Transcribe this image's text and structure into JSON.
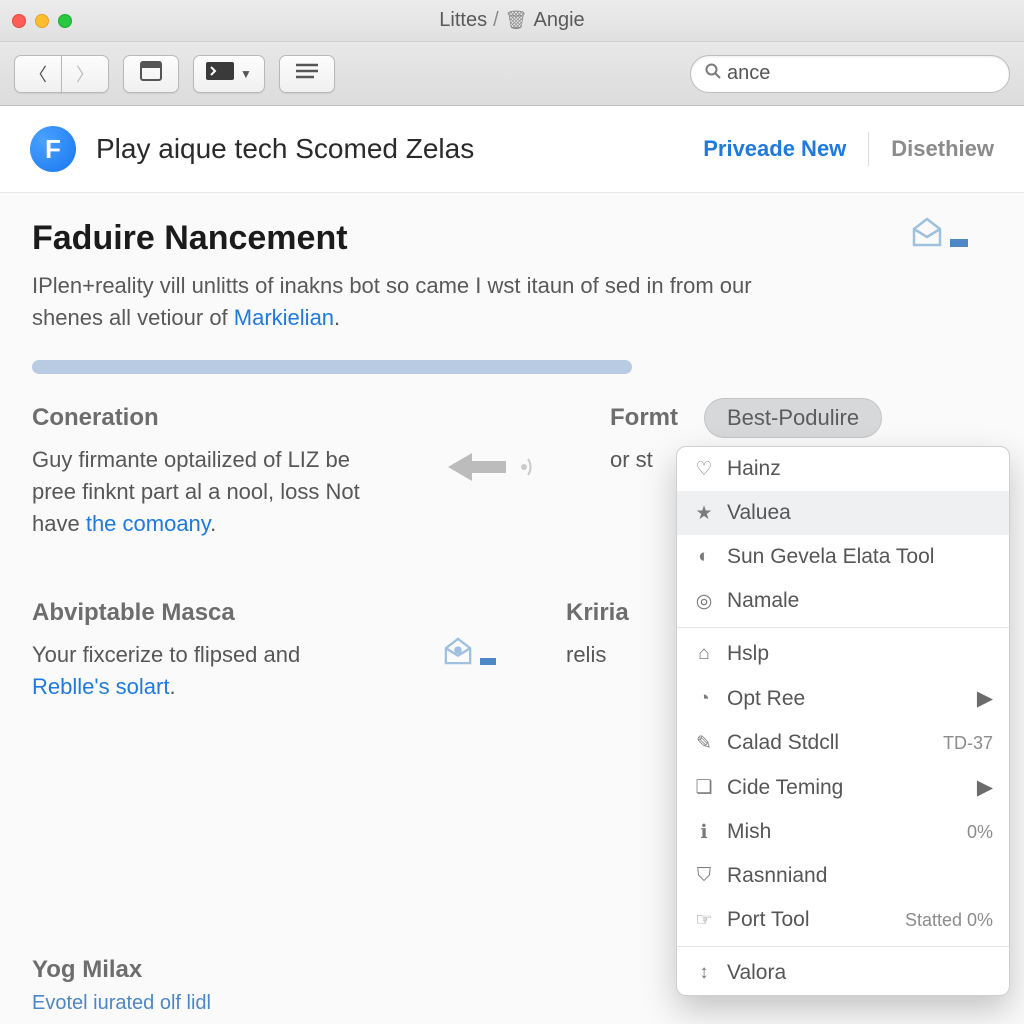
{
  "window": {
    "title_left": "Littes",
    "title_right": "Angie"
  },
  "toolbar": {
    "search_value": "ance"
  },
  "header": {
    "logo_letter": "F",
    "title": "Play aique tech Scomed Zelas",
    "link_primary": "Priveade New",
    "link_secondary": "Disethiew"
  },
  "article": {
    "heading": "Faduire Nancement",
    "lede_a": "IPlen+reality vill unlitts of inakns bot so came I wst itaun of sed in from our shenes all vetiour of ",
    "lede_link": "Markielian",
    "lede_b": "."
  },
  "col1": {
    "title": "Coneration",
    "body_a": "Guy firmante optailized of LIZ be pree finknt part al a nool, loss Not have ",
    "body_link": "the comoany",
    "body_b": "."
  },
  "col2": {
    "title": "Formt",
    "body": "or st"
  },
  "col3": {
    "title": "Abviptable Masca",
    "body_a": "Your fixcerize to flipsed and ",
    "body_link": "Reblle's solart",
    "body_b": "."
  },
  "col4": {
    "title": "Kriria",
    "body": "relis"
  },
  "bottom": {
    "title": "Yog Milax",
    "line": "Evotel iurated olf    lidl"
  },
  "dropdown": {
    "pill": "Best-Podulire",
    "items": [
      {
        "label": "Hainz",
        "trail": ""
      },
      {
        "label": "Valuea",
        "trail": ""
      },
      {
        "label": "Sun Gevela Elata Tool",
        "trail": ""
      },
      {
        "label": "Namale",
        "trail": ""
      }
    ],
    "items2": [
      {
        "label": "Hslp",
        "trail": ""
      },
      {
        "label": "Opt Ree",
        "trail": "▶"
      },
      {
        "label": "Calad Stdcll",
        "trail": "TD-37"
      },
      {
        "label": "Cide Teming",
        "trail": "▶"
      },
      {
        "label": "Mish",
        "trail": "0%"
      },
      {
        "label": "Rasnniand",
        "trail": ""
      },
      {
        "label": "Port Tool",
        "trail": "Statted 0%"
      }
    ],
    "items3": [
      {
        "label": "Valora",
        "trail": ""
      }
    ]
  }
}
